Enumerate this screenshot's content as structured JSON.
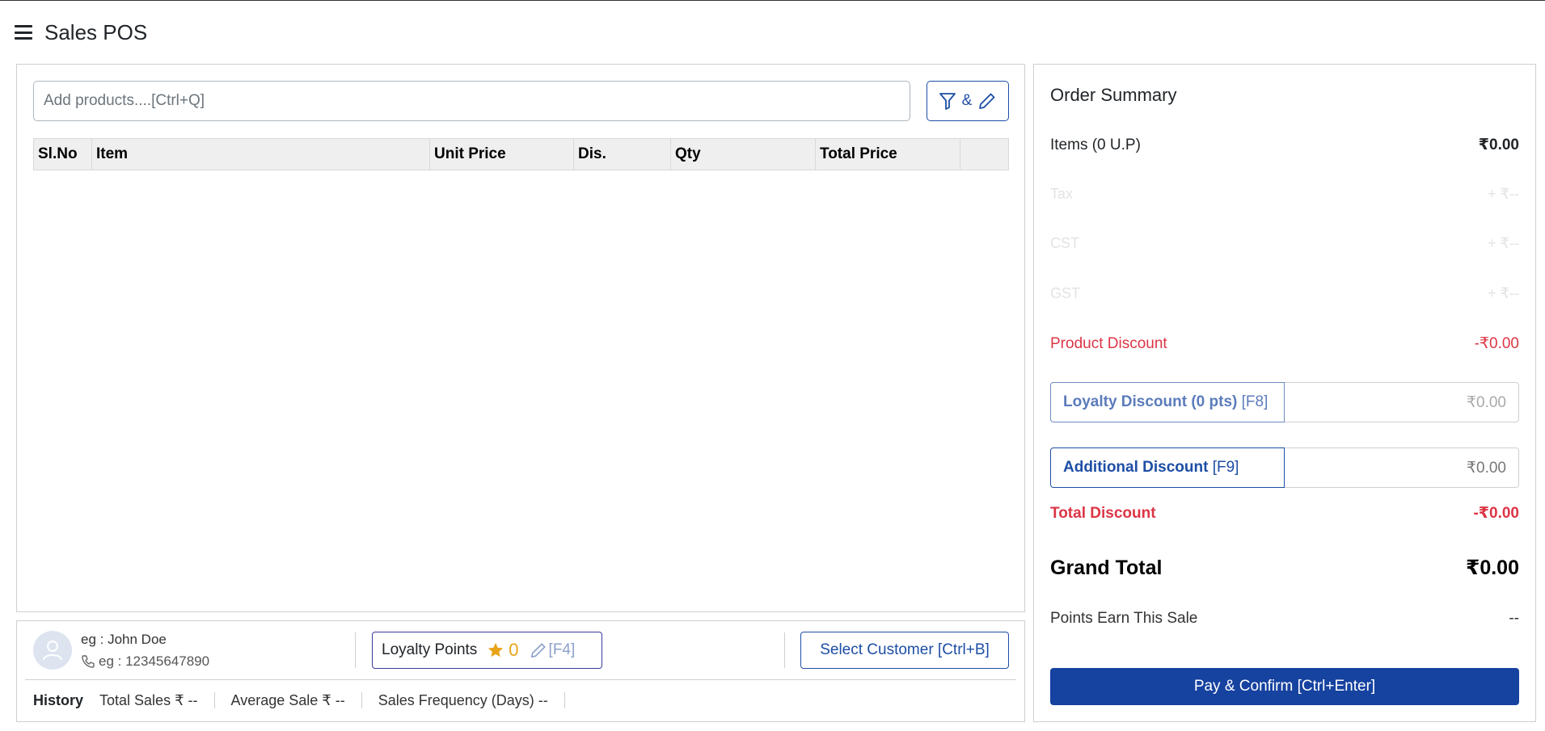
{
  "header": {
    "title": "Sales POS"
  },
  "search": {
    "placeholder": "Add products....[Ctrl+Q]"
  },
  "filter_button": {
    "separator": "&"
  },
  "table": {
    "columns": [
      "Sl.No",
      "Item",
      "Unit Price",
      "Dis.",
      "Qty",
      "Total Price",
      ""
    ]
  },
  "customer": {
    "name_placeholder": "eg : John Doe",
    "phone_placeholder": "eg : 12345647890",
    "loyalty_label": "Loyalty Points",
    "loyalty_points": "0",
    "loyalty_shortcut": "[F4]",
    "select_button": "Select Customer [Ctrl+B]"
  },
  "history": {
    "label": "History",
    "total_sales": "Total Sales ₹ --",
    "average_sale": "Average Sale ₹ --",
    "sales_frequency": "Sales Frequency (Days) --"
  },
  "summary": {
    "title": "Order Summary",
    "items_label": "Items (0 U.P)",
    "items_value": "₹0.00",
    "tax_label": "Tax",
    "tax_value": "+ ₹--",
    "cst_label": "CST",
    "cst_value": "+ ₹--",
    "gst_label": "GST",
    "gst_value": "+ ₹--",
    "product_discount_label": "Product Discount",
    "product_discount_value": "-₹0.00",
    "loyalty_discount_label": "Loyalty Discount (0 pts)",
    "loyalty_discount_shortcut": "[F8]",
    "loyalty_discount_value": "₹0.00",
    "additional_discount_label": "Additional Discount",
    "additional_discount_shortcut": "[F9]",
    "additional_discount_value": "₹0.00",
    "total_discount_label": "Total Discount",
    "total_discount_value": "-₹0.00",
    "grand_total_label": "Grand Total",
    "grand_total_value": "₹0.00",
    "points_earn_label": "Points Earn This Sale",
    "points_earn_value": "--",
    "pay_button": "Pay & Confirm [Ctrl+Enter]"
  },
  "colors": {
    "primary": "#1642a0",
    "outline": "#1d4ea5",
    "danger": "#dc3545",
    "star": "#e8a317"
  },
  "icons": [
    "menu-icon",
    "filter-icon",
    "pencil-icon",
    "user-icon",
    "phone-icon",
    "star-icon"
  ]
}
